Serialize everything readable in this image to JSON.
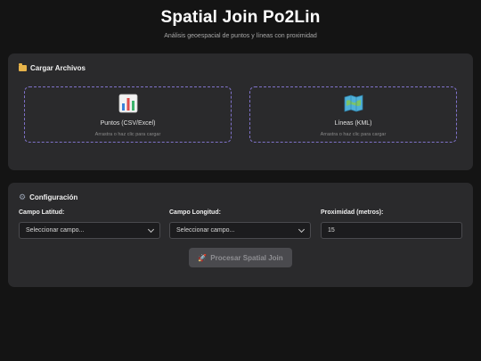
{
  "header": {
    "title": "Spatial Join Po2Lin",
    "subtitle": "Análisis geoespacial de puntos y líneas con proximidad"
  },
  "upload": {
    "heading": "Cargar Archivos",
    "heading_icon": "folder-icon",
    "points": {
      "icon": "bar-chart-icon",
      "title": "Puntos (CSV/Excel)",
      "hint": "Arrastra o haz clic para cargar"
    },
    "lines": {
      "icon": "map-icon",
      "title": "Líneas (KML)",
      "hint": "Arrastra o haz clic para cargar"
    }
  },
  "config": {
    "heading": "Configuración",
    "heading_icon": "gear-icon",
    "lat": {
      "label": "Campo Latitud:",
      "selected": "Seleccionar campo..."
    },
    "lon": {
      "label": "Campo Longitud:",
      "selected": "Seleccionar campo..."
    },
    "proximity": {
      "label": "Proximidad (metros):",
      "value": "15"
    },
    "process_label": "Procesar Spatial Join",
    "process_icon": "rocket-icon"
  },
  "colors": {
    "background": "#141414",
    "panel": "#2a2a2c",
    "dropzone_border": "#7f72c9",
    "button_disabled": "#4a4a4e"
  }
}
